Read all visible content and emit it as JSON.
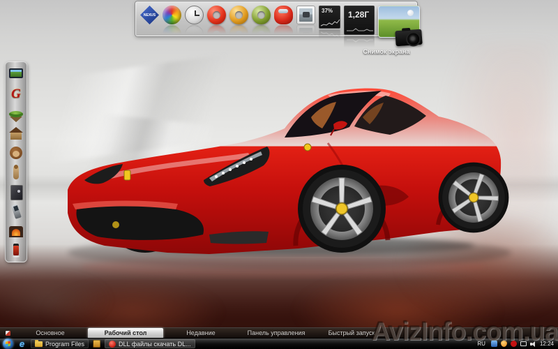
{
  "watermark": {
    "text": "AvizInfo.com.ua"
  },
  "wallpaper": {
    "subject": "red Ferrari 458 Italia on light gray studio floor with dark red smoke",
    "car_color": "#d91a12",
    "smoke_color": "#3a150f"
  },
  "top_dock": {
    "icons": [
      {
        "id": "nexus-logo",
        "label": "NEXUS"
      },
      {
        "id": "winstep-pinwheel-icon"
      },
      {
        "id": "clock-icon"
      },
      {
        "id": "power-button-red-icon"
      },
      {
        "id": "power-button-orange-icon"
      },
      {
        "id": "power-button-green-icon"
      },
      {
        "id": "red-car-icon"
      },
      {
        "id": "photo-viewer-icon"
      }
    ],
    "cpu_meter": {
      "value": "37%"
    },
    "network_meter": {
      "value": "1,28Г"
    },
    "screenshot_label": "Снимок экрана"
  },
  "left_dock": {
    "icons": [
      {
        "id": "tv-icon"
      },
      {
        "id": "red-letter-logo-icon",
        "glyph": "G"
      },
      {
        "id": "floating-island-icon"
      },
      {
        "id": "house-icon"
      },
      {
        "id": "monkey-icon"
      },
      {
        "id": "meerkat-icon"
      },
      {
        "id": "safe-icon"
      },
      {
        "id": "mobile-phone-icon"
      },
      {
        "id": "fireplace-icon"
      },
      {
        "id": "red-figure-icon"
      }
    ]
  },
  "tab_bar": {
    "tabs": [
      {
        "label": "Основное",
        "active": false
      },
      {
        "label": "Рабочий стол",
        "active": true
      },
      {
        "label": "Недавние",
        "active": false
      },
      {
        "label": "Панель управления",
        "active": false
      },
      {
        "label": "Быстрый запуск",
        "active": false
      }
    ]
  },
  "taskbar": {
    "ie_glyph": "e",
    "buttons": [
      {
        "label": "Program Files"
      },
      {
        "label": "DLL файлы скачать DL..."
      }
    ],
    "tray": {
      "language": "RU",
      "time": "12:24"
    }
  }
}
